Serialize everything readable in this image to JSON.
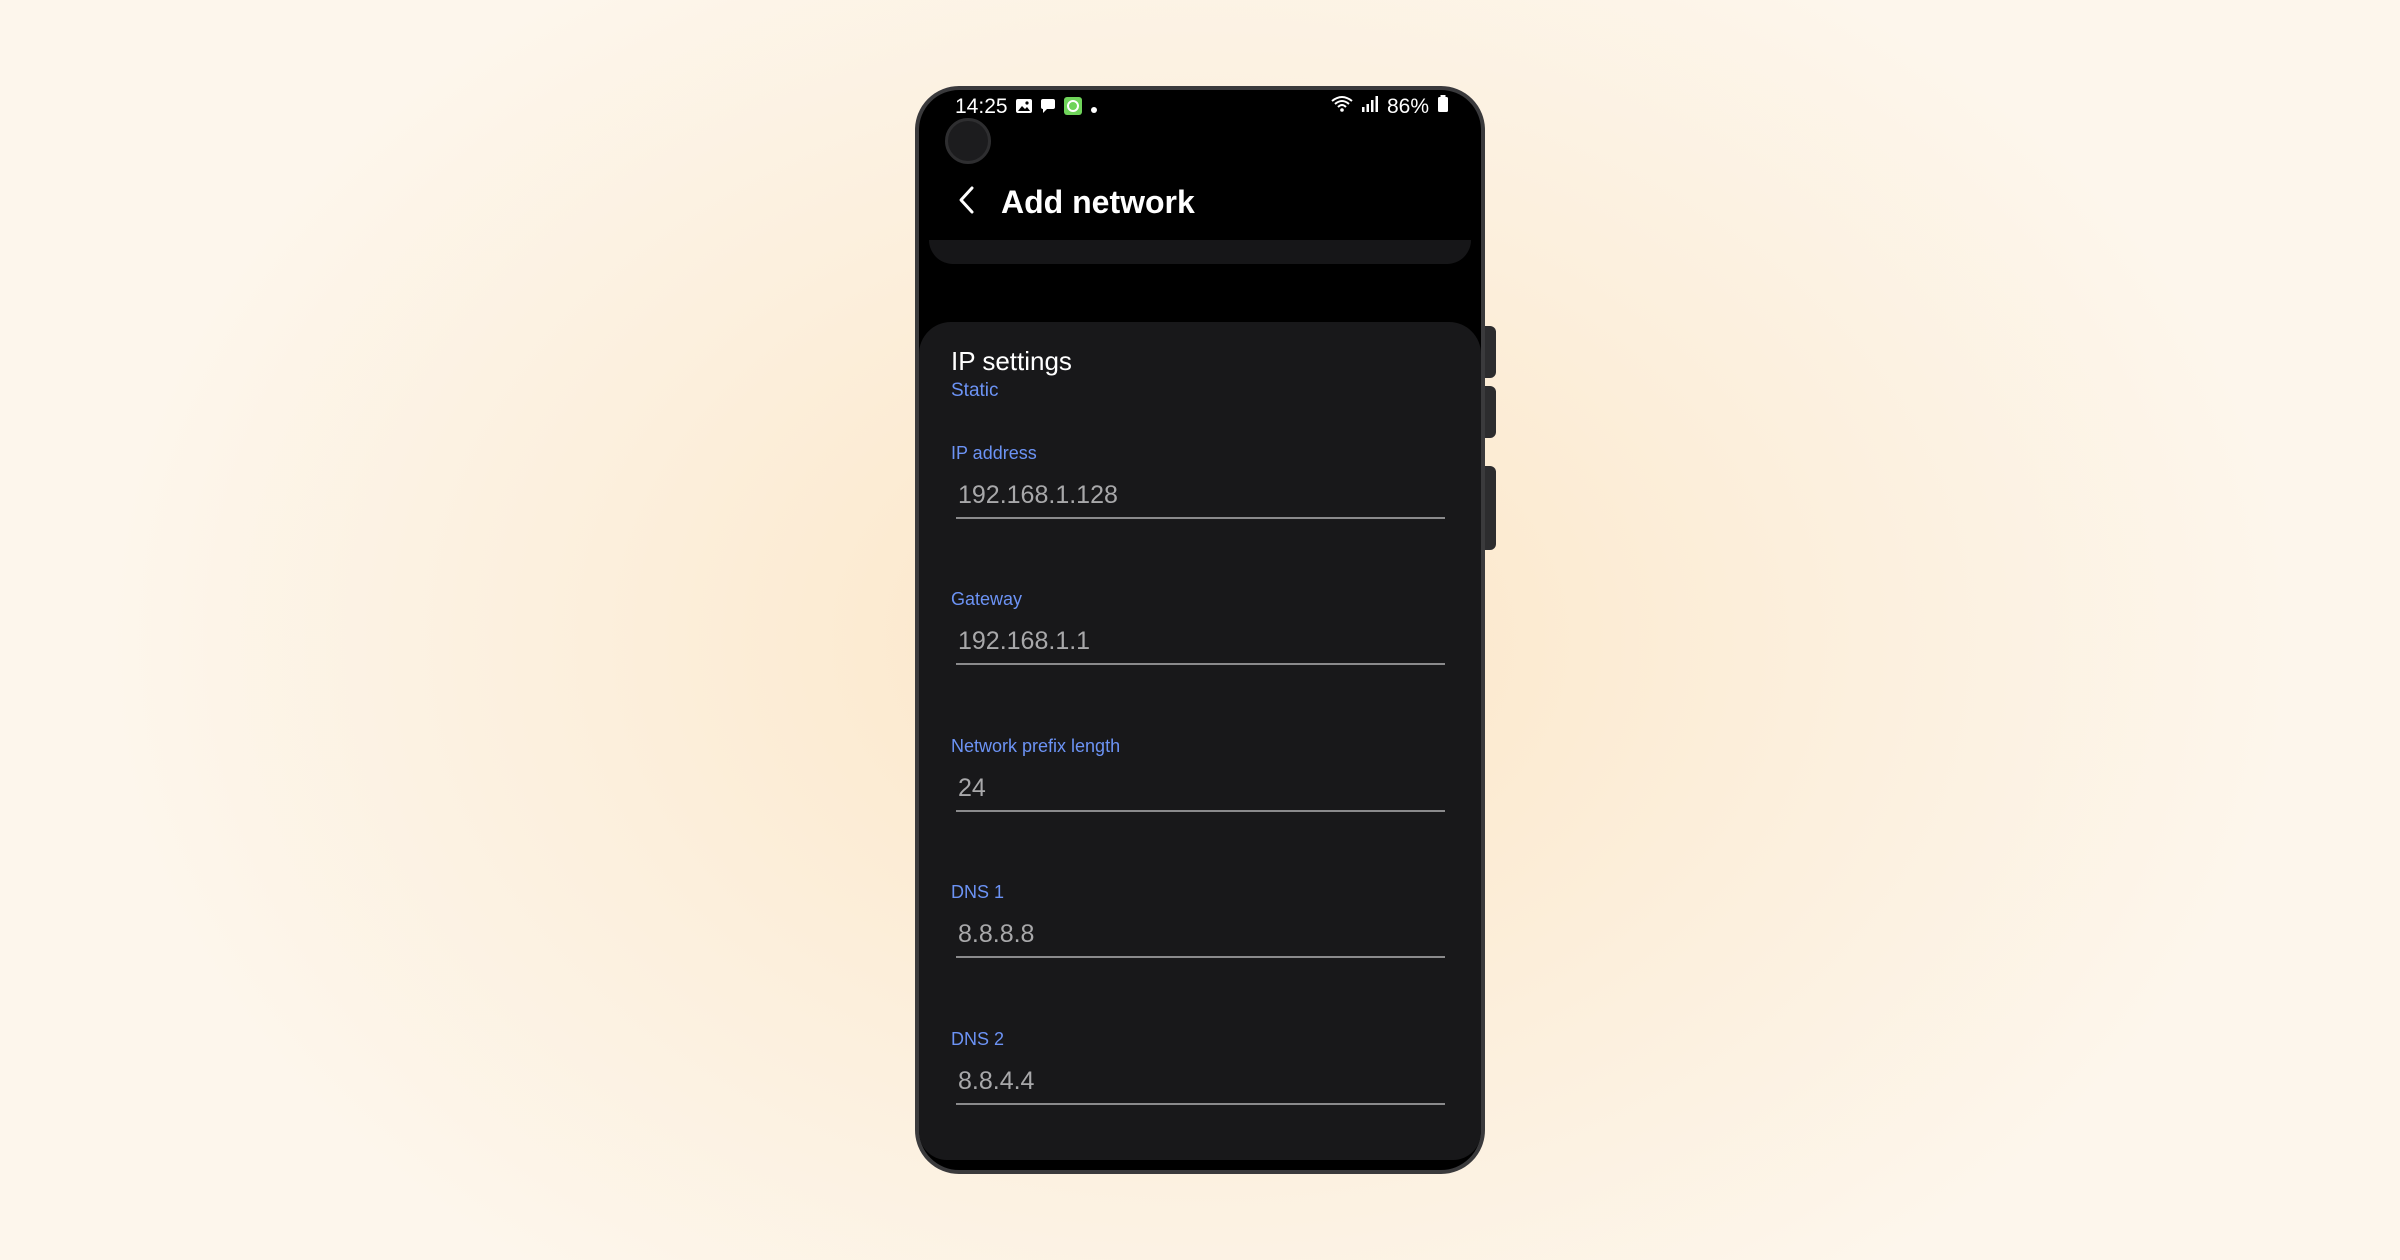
{
  "status_bar": {
    "time": "14:25",
    "battery": "86%"
  },
  "header": {
    "title": "Add network"
  },
  "ip_settings": {
    "title": "IP settings",
    "mode": "Static"
  },
  "fields": {
    "ip_address": {
      "label": "IP address",
      "value": "192.168.1.128"
    },
    "gateway": {
      "label": "Gateway",
      "value": "192.168.1.1"
    },
    "prefix_length": {
      "label": "Network prefix length",
      "value": "24"
    },
    "dns1": {
      "label": "DNS 1",
      "value": "8.8.8.8"
    },
    "dns2": {
      "label": "DNS 2",
      "value": "8.8.4.4"
    }
  },
  "colors": {
    "accent": "#6c93f5",
    "background": "#000000",
    "card": "#18181a"
  },
  "icons": [
    "gallery-icon",
    "chat-icon",
    "app-notification-icon",
    "dot-icon",
    "wifi-icon",
    "signal-icon",
    "battery-icon",
    "back-arrow-icon"
  ]
}
